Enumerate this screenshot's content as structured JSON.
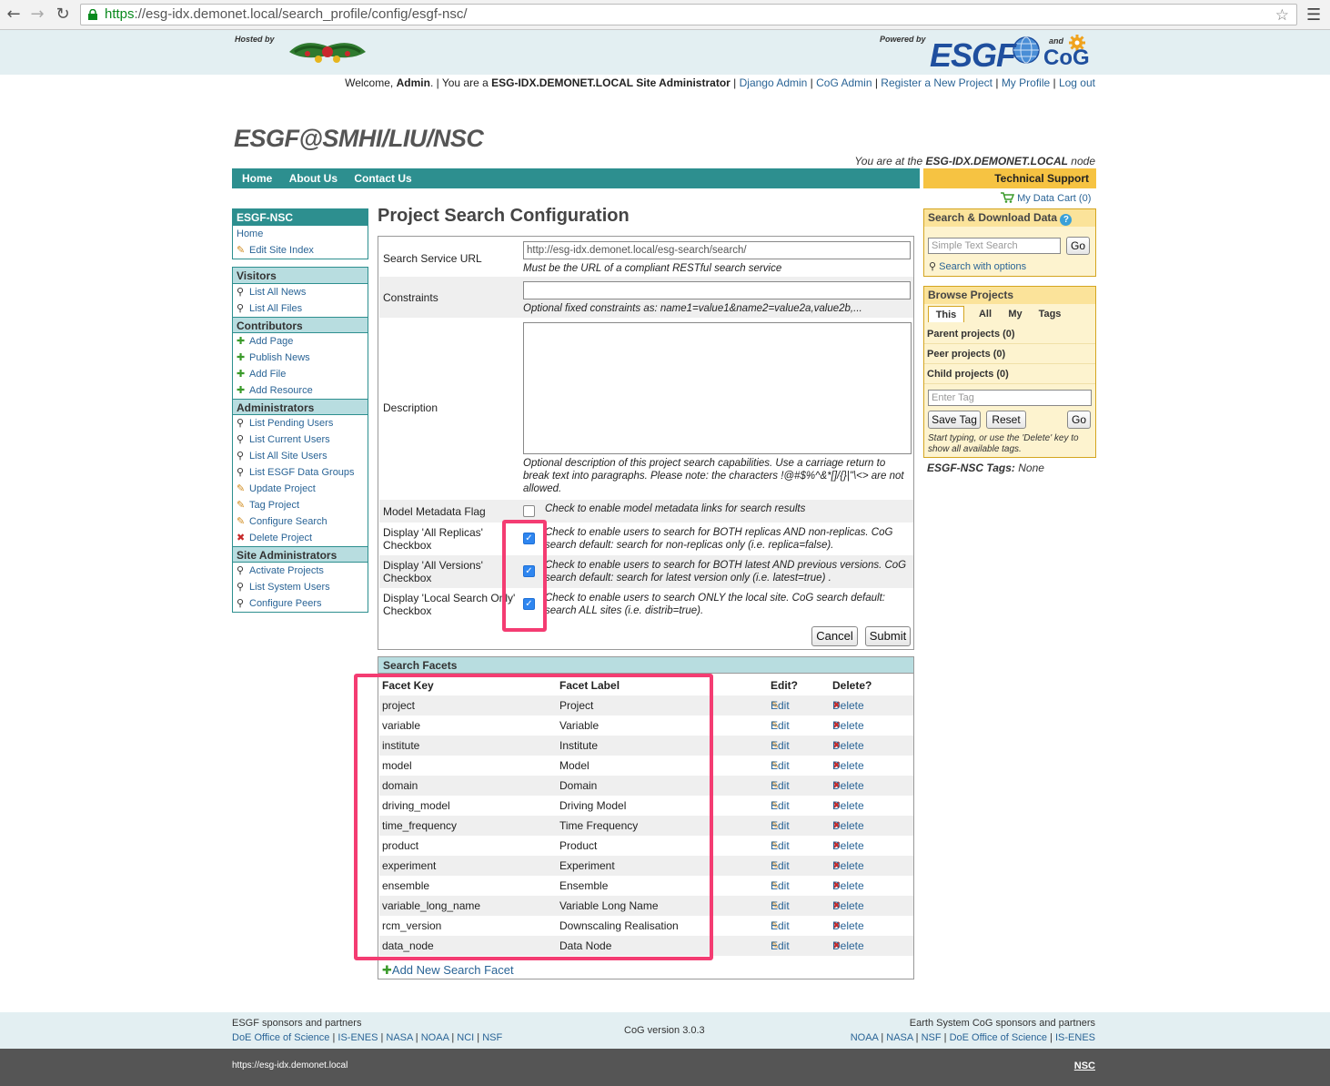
{
  "browser": {
    "url_scheme": "https",
    "url_rest": "://esg-idx.demonet.local/search_profile/config/esgf-nsc/"
  },
  "banner": {
    "hosted_by": "Hosted by",
    "powered_by": "Powered by",
    "and": "and",
    "esgf_logo": "ESGF",
    "cog_logo": "CoG"
  },
  "welcome": {
    "prefix": "Welcome,",
    "user": "Admin",
    "you_are": ". | You are a",
    "role": "ESG-IDX.DEMONET.LOCAL Site Administrator",
    "links": [
      "Django Admin",
      "CoG Admin",
      "Register a New Project",
      "My Profile",
      "Log out"
    ]
  },
  "site_title": "ESGF@SMHI/LIU/NSC",
  "node_note": {
    "prefix": "You are at the",
    "node": "ESG-IDX.DEMONET.LOCAL",
    "suffix": "node"
  },
  "navbar": {
    "items": [
      "Home",
      "About Us",
      "Contact Us"
    ],
    "tech_support": "Technical Support",
    "data_cart": "My Data Cart (0)"
  },
  "left_sidebar": {
    "project": {
      "title": "ESGF-NSC",
      "items": [
        "Home",
        "Edit Site Index"
      ]
    },
    "visitors": {
      "title": "Visitors",
      "items": [
        "List All News",
        "List All Files"
      ]
    },
    "contributors": {
      "title": "Contributors",
      "items": [
        "Add Page",
        "Publish News",
        "Add File",
        "Add Resource"
      ]
    },
    "administrators": {
      "title": "Administrators",
      "items": [
        "List Pending Users",
        "List Current Users",
        "List All Site Users",
        "List ESGF Data Groups",
        "Update Project",
        "Tag Project",
        "Configure Search",
        "Delete Project"
      ]
    },
    "site_admins": {
      "title": "Site Administrators",
      "items": [
        "Activate Projects",
        "List System Users",
        "Configure Peers"
      ]
    }
  },
  "main": {
    "title": "Project Search Configuration",
    "form": {
      "url_label": "Search Service URL",
      "url_value": "http://esg-idx.demonet.local/esg-search/search/",
      "url_help": "Must be the URL of a compliant RESTful search service",
      "constraints_label": "Constraints",
      "constraints_help": "Optional fixed constraints as: name1=value1&name2=value2a,value2b,...",
      "description_label": "Description",
      "description_help": "Optional description of this project search capabilities. Use a carriage return to break text into paragraphs. Please note: the characters !@#$%^&*[]/{}|\"\\<> are not allowed.",
      "model_flag_label": "Model Metadata Flag",
      "model_flag_help": "Check to enable model metadata links for search results",
      "replicas_label": "Display 'All Replicas' Checkbox",
      "replicas_help": "Check to enable users to search for BOTH replicas AND non-replicas. CoG search default: search for non-replicas only (i.e. replica=false).",
      "versions_label": "Display 'All Versions' Checkbox",
      "versions_help": "Check to enable users to search for BOTH latest AND previous versions. CoG search default: search for latest version only (i.e. latest=true) .",
      "local_label": "Display 'Local Search Only' Checkbox",
      "local_help": "Check to enable users to search ONLY the local site. CoG search default: search ALL sites (i.e. distrib=true).",
      "cancel": "Cancel",
      "submit": "Submit"
    },
    "facets": {
      "title": "Search Facets",
      "headers": [
        "Facet Key",
        "Facet Label",
        "Edit?",
        "Delete?"
      ],
      "edit_label": "Edit",
      "delete_label": "Delete",
      "rows": [
        {
          "key": "project",
          "label": "Project"
        },
        {
          "key": "variable",
          "label": "Variable"
        },
        {
          "key": "institute",
          "label": "Institute"
        },
        {
          "key": "model",
          "label": "Model"
        },
        {
          "key": "domain",
          "label": "Domain"
        },
        {
          "key": "driving_model",
          "label": "Driving Model"
        },
        {
          "key": "time_frequency",
          "label": "Time Frequency"
        },
        {
          "key": "product",
          "label": "Product"
        },
        {
          "key": "experiment",
          "label": "Experiment"
        },
        {
          "key": "ensemble",
          "label": "Ensemble"
        },
        {
          "key": "variable_long_name",
          "label": "Variable Long Name"
        },
        {
          "key": "rcm_version",
          "label": "Downscaling Realisation"
        },
        {
          "key": "data_node",
          "label": "Data Node"
        }
      ],
      "add_new": "Add New Search Facet"
    }
  },
  "right_sidebar": {
    "search": {
      "title": "Search & Download Data",
      "placeholder": "Simple Text Search",
      "go": "Go",
      "with_options": "Search with options"
    },
    "browse": {
      "title": "Browse Projects",
      "tabs": [
        "This",
        "All",
        "My",
        "Tags"
      ],
      "rows": [
        "Parent projects (0)",
        "Peer projects (0)",
        "Child projects (0)"
      ],
      "tag_placeholder": "Enter Tag",
      "save_tag": "Save Tag",
      "reset": "Reset",
      "go": "Go",
      "hint": "Start typing, or use the 'Delete' key to show all available tags."
    },
    "tags_line_label": "ESGF-NSC Tags:",
    "tags_line_value": "None"
  },
  "footer": {
    "left_title": "ESGF sponsors and partners",
    "left_links": [
      "DoE Office of Science",
      "IS-ENES",
      "NASA",
      "NOAA",
      "NCI",
      "NSF"
    ],
    "center": "CoG version 3.0.3",
    "right_title": "Earth System CoG sponsors and partners",
    "right_links": [
      "NOAA",
      "NASA",
      "NSF",
      "DoE Office of Science",
      "IS-ENES"
    ],
    "bottom_url": "https://esg-idx.demonet.local",
    "bottom_right": "NSC"
  }
}
